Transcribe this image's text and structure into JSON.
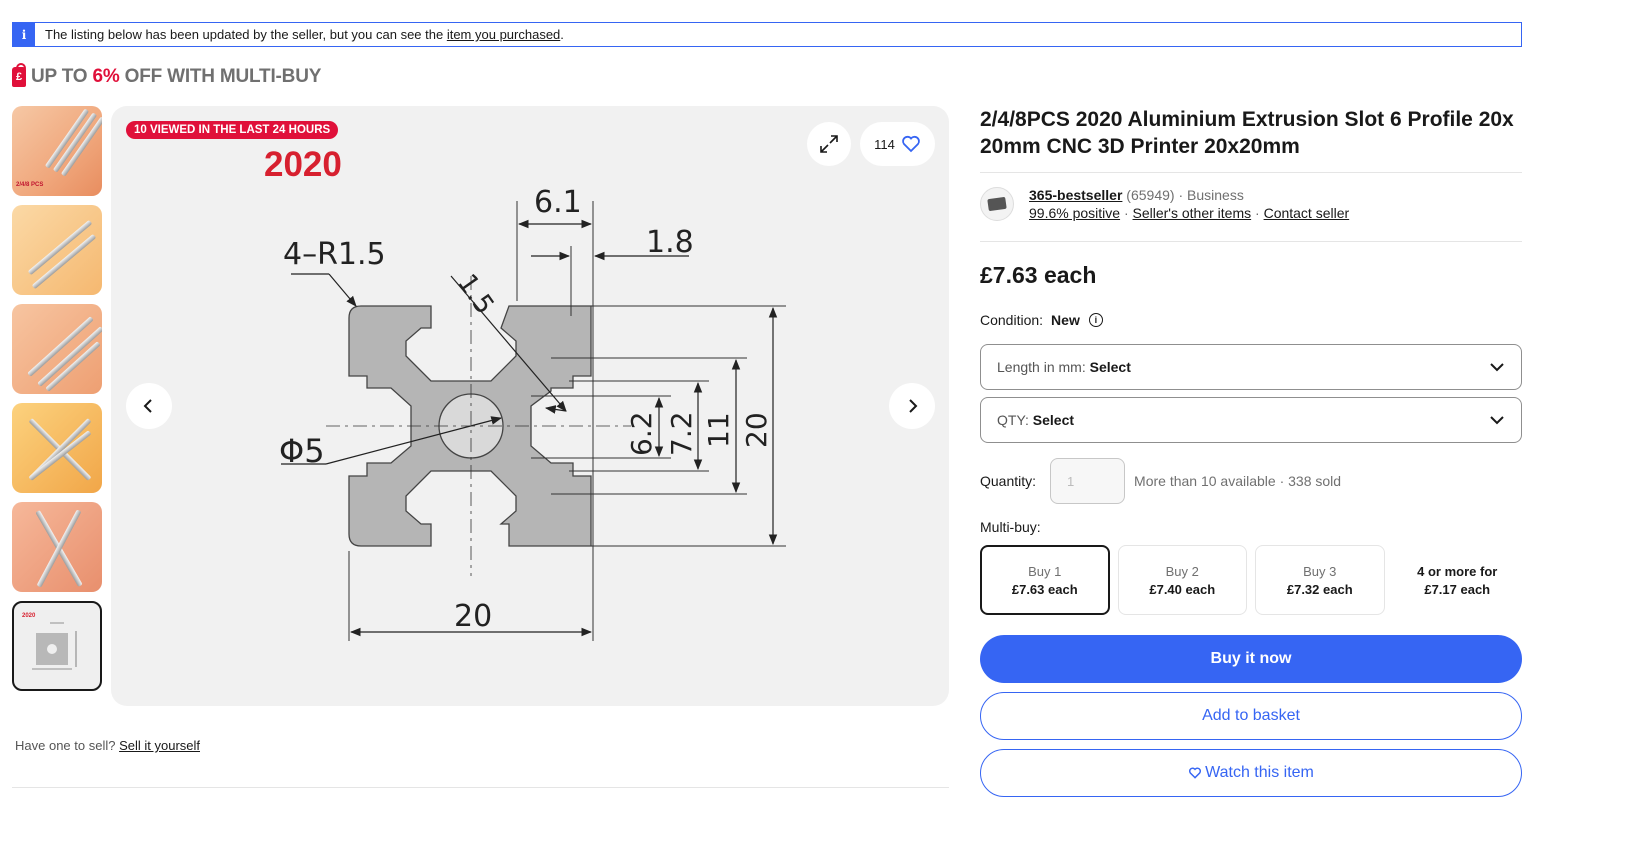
{
  "notice": {
    "icon": "info-icon",
    "text_before": "The listing below has been updated by the seller, but you can see the ",
    "link": "item you purchased",
    "text_after": "."
  },
  "promo": {
    "prefix": "UP TO ",
    "percent": "6%",
    "suffix": " OFF WITH MULTI-BUY",
    "color": "#e0103a"
  },
  "gallery": {
    "viewed_badge": "10 VIEWED IN THE LAST 24 HOURS",
    "watch_count": "114",
    "image_caption": "2020",
    "thumb_caption": "2/4/8 PCS",
    "thumbnails": [
      {
        "name": "thumb-1"
      },
      {
        "name": "thumb-2"
      },
      {
        "name": "thumb-3"
      },
      {
        "name": "thumb-4"
      },
      {
        "name": "thumb-5"
      },
      {
        "name": "thumb-6",
        "selected": true
      }
    ],
    "drawing_labels": {
      "dim_6_1": "6.1",
      "dim_1_8": "1.8",
      "radius": "4–R1.5",
      "dim_1_5": "1.5",
      "phi": "Φ5",
      "dim_6_2": "6.2",
      "dim_7_2": "7.2",
      "dim_11": "11",
      "dim_20_v": "20",
      "dim_20_h": "20"
    }
  },
  "sell_prompt": {
    "text": "Have one to sell? ",
    "link": "Sell it yourself"
  },
  "product": {
    "title": "2/4/8PCS 2020 Aluminium Extrusion Slot 6 Profile 20x 20mm CNC 3D Printer 20x20mm",
    "seller": {
      "name": "365-bestseller",
      "feedback_count": "(65949)",
      "separator": " · ",
      "type": "Business",
      "positive": "99.6% positive",
      "other_items": "Seller's other items",
      "contact": "Contact seller"
    },
    "price": "£7.63 each",
    "condition_label": "Condition:",
    "condition_value": "New",
    "variations": [
      {
        "label": "Length in mm: ",
        "value": "Select"
      },
      {
        "label": "QTY: ",
        "value": "Select"
      }
    ],
    "quantity_label": "Quantity:",
    "quantity_placeholder": "1",
    "availability": "More than 10 available · 338 sold",
    "multibuy_label": "Multi-buy:",
    "tiers": [
      {
        "amount": "Buy 1",
        "price": "£7.63 each",
        "selected": true
      },
      {
        "amount": "Buy 2",
        "price": "£7.40 each"
      },
      {
        "amount": "Buy 3",
        "price": "£7.32 each"
      },
      {
        "amount": "4 or more for",
        "price": "£7.17 each"
      }
    ],
    "buy_now": "Buy it now",
    "add_to_basket": "Add to basket",
    "watch": "Watch this item",
    "accent_color": "#3665f3"
  }
}
